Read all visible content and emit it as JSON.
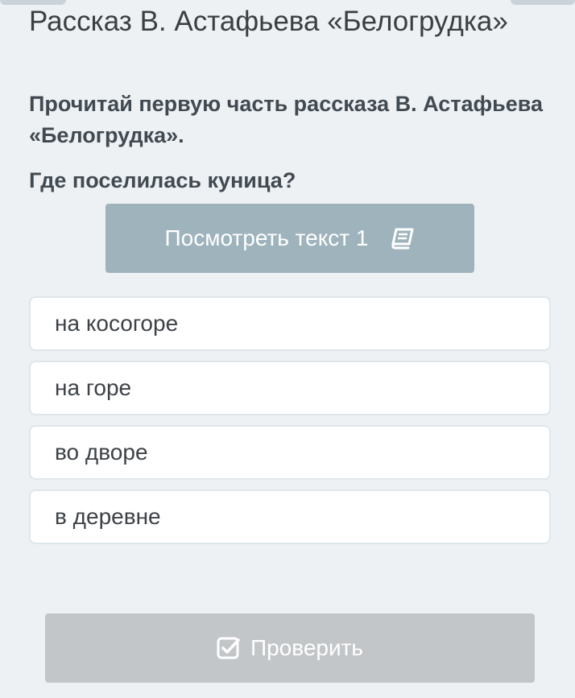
{
  "header": {
    "title": "Рассказ В. Астафьева «Белогрудка»"
  },
  "question": {
    "instruction": "Прочитай первую часть рассказа В. Астафьева «Белогрудка».",
    "prompt": "Где поселилась куница?"
  },
  "view_text_button": {
    "label": "Посмотреть текст 1",
    "icon": "book-icon"
  },
  "options": [
    {
      "label": "на косогоре"
    },
    {
      "label": "на горе"
    },
    {
      "label": "во дворе"
    },
    {
      "label": "в деревне"
    }
  ],
  "check_button": {
    "label": "Проверить",
    "icon": "checkbox-check-icon"
  },
  "colors": {
    "background": "#eef1f3",
    "view_button": "#9fb3bd",
    "check_button_disabled": "#c3c6c9",
    "option_border": "#dfe6ea"
  }
}
